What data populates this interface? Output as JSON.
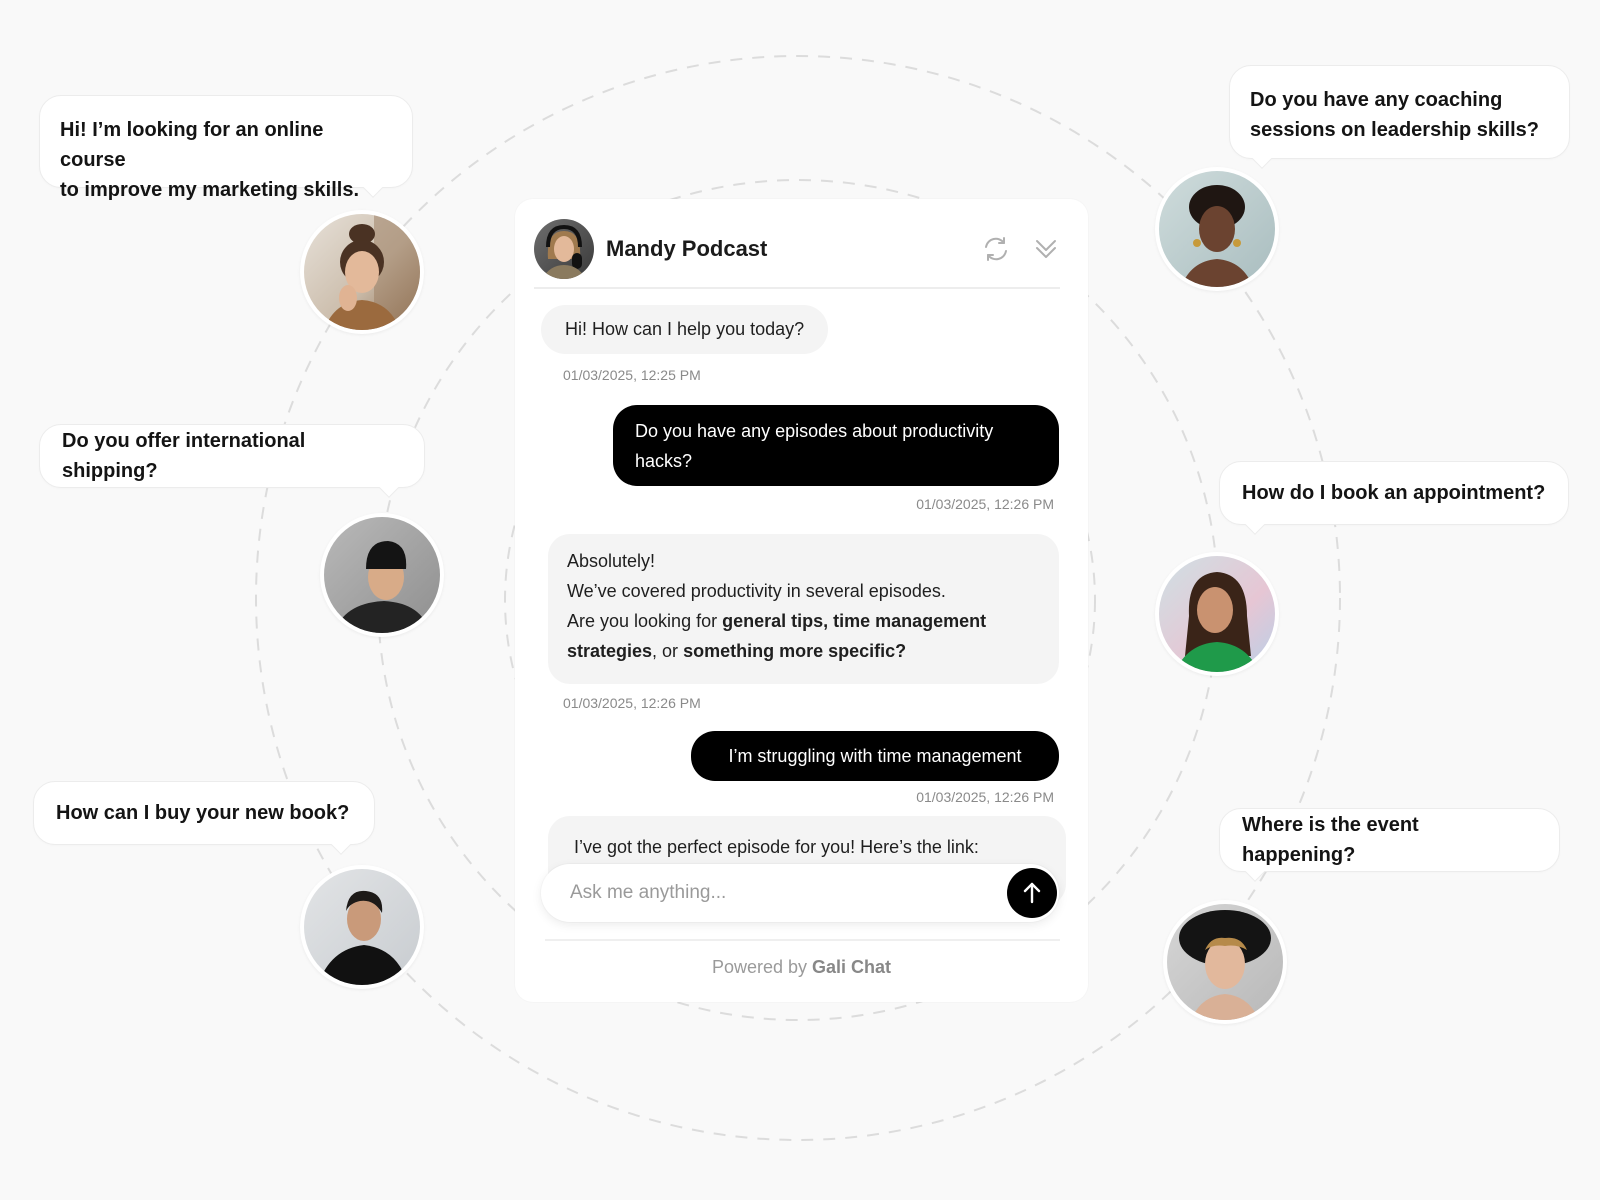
{
  "chat": {
    "title": "Mandy Podcast",
    "header_icons": [
      "refresh-icon",
      "collapse-chevrons-icon"
    ],
    "messages": [
      {
        "role": "bot",
        "text": "Hi! How can I help you today?",
        "time": "01/03/2025, 12:25 PM"
      },
      {
        "role": "user",
        "text": "Do you have any episodes about productivity hacks?",
        "line1": "Do you have any episodes about productivity",
        "line2": "hacks?",
        "time": "01/03/2025, 12:26 PM"
      },
      {
        "role": "bot",
        "line1": "Absolutely!",
        "line2": "We’ve covered productivity in several episodes.",
        "line3_plain": "Are you looking for ",
        "line3_bold": "general tips, time management",
        "line4_bold1": "strategies",
        "line4_plain": ", or ",
        "line4_bold2": "something more specific?",
        "time": "01/03/2025, 12:26 PM"
      },
      {
        "role": "user",
        "text": "I’m struggling with time management",
        "time": "01/03/2025, 12:26 PM"
      },
      {
        "role": "bot",
        "text": "I’ve got the perfect episode for you! Here’s the link:"
      }
    ],
    "input": {
      "placeholder": "Ask me anything...",
      "value": ""
    },
    "send_icon": "arrow-up-icon",
    "footer": {
      "prefix": "Powered by ",
      "brand": "Gali Chat"
    }
  },
  "floating_questions": [
    {
      "text_line1": "Hi! I’m looking for an online course",
      "text_line2": "to improve my marketing skills.",
      "avatar": "woman-hair-bun-avatar"
    },
    {
      "text": "Do you offer international shipping?",
      "avatar": "man-beanie-avatar"
    },
    {
      "text": "How can I buy your new book?",
      "avatar": "man-turtleneck-avatar"
    },
    {
      "text_line1": "Do you have any coaching",
      "text_line2": "sessions on leadership skills?",
      "avatar": "woman-curly-hair-avatar"
    },
    {
      "text": "How do I book an appointment?",
      "avatar": "woman-smiling-avatar"
    },
    {
      "text": "Where is the event happening?",
      "avatar": "man-hat-avatar"
    }
  ],
  "colors": {
    "background": "#f9f9f9",
    "user_bubble": "#000000",
    "bot_bubble": "#f4f4f4",
    "timestamp": "#8a8a8a",
    "ring": "#dcdcdc"
  }
}
